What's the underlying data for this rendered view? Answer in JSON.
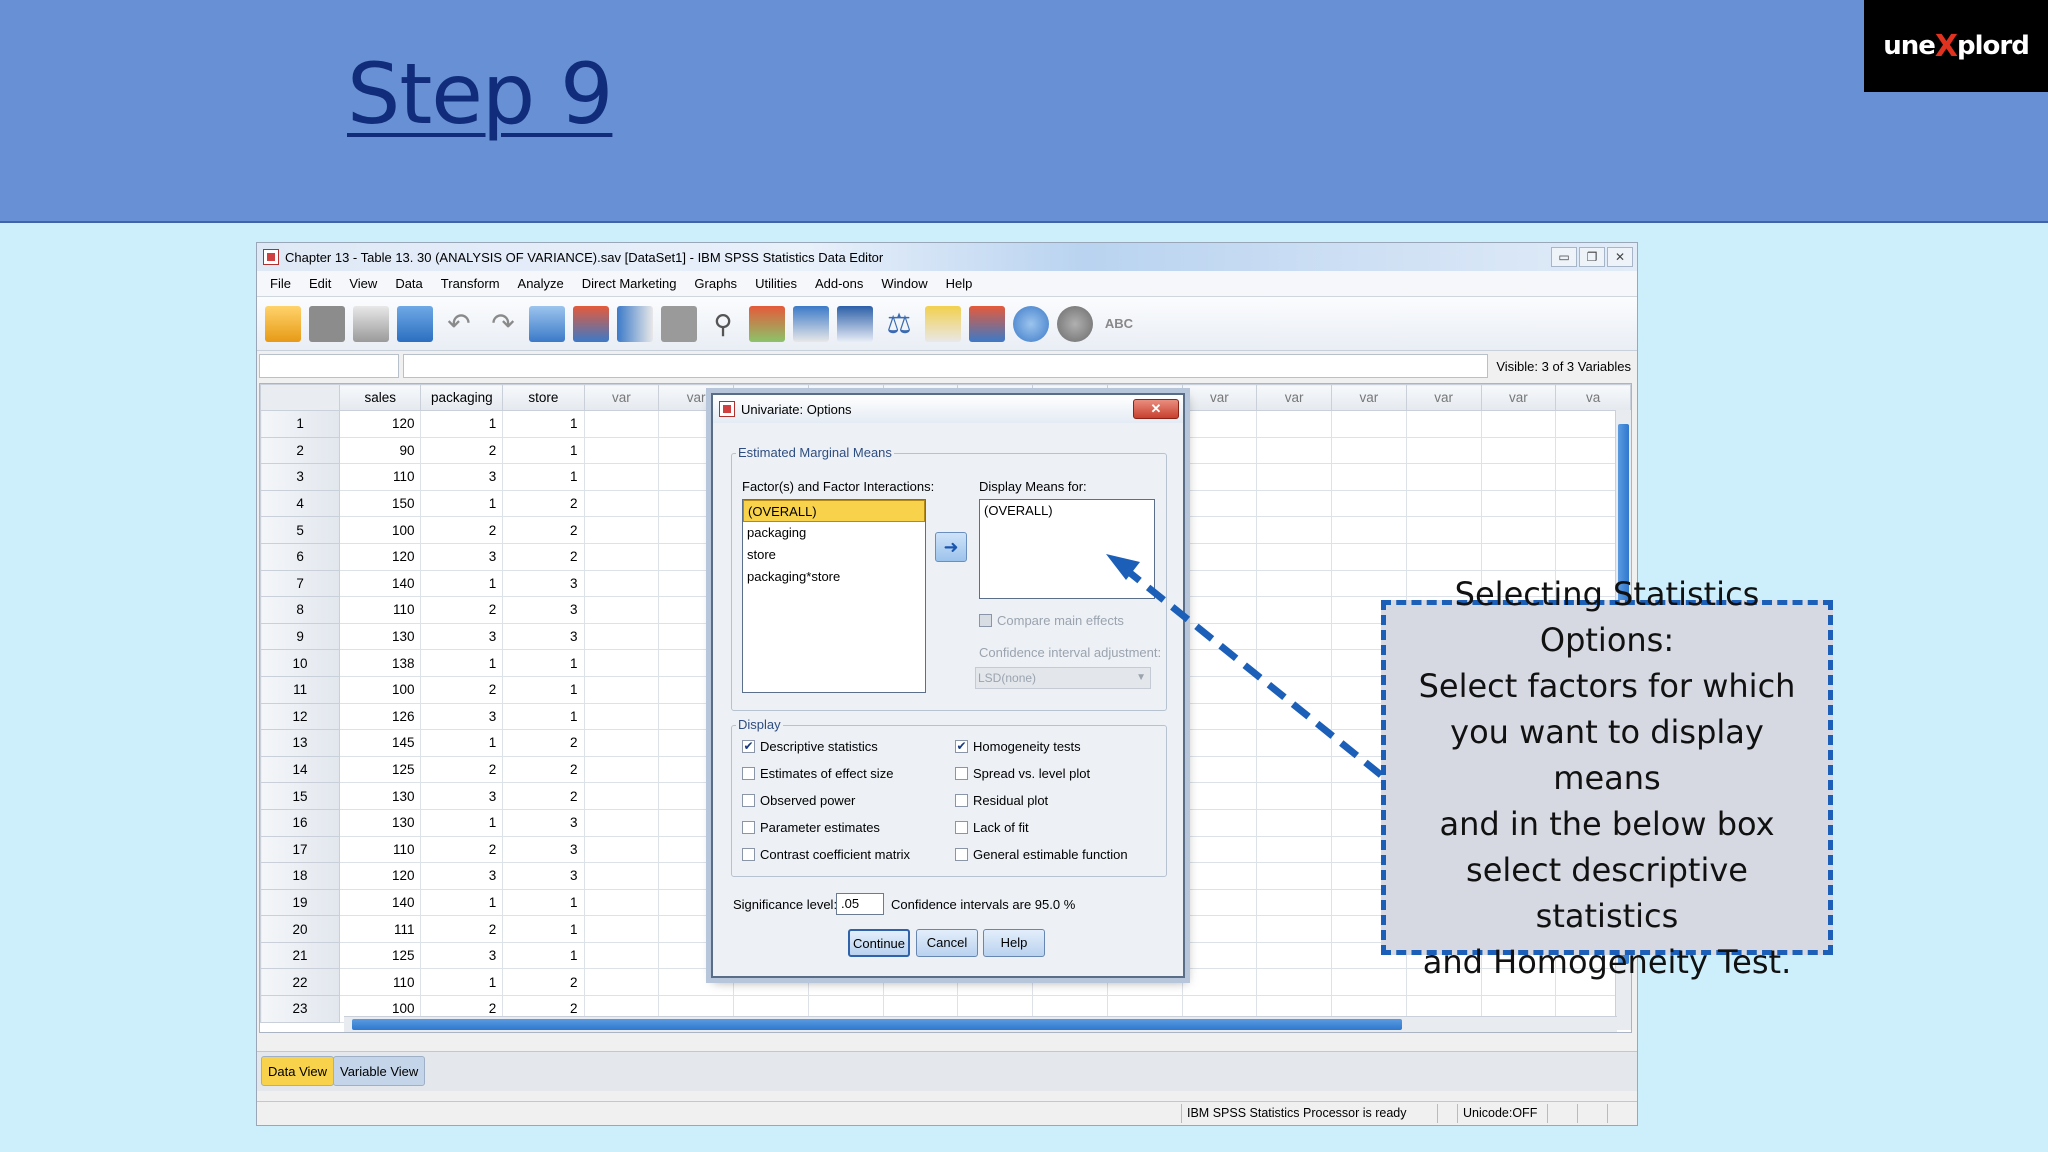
{
  "slide": {
    "title": "Step 9",
    "logo_prefix": "une",
    "logo_x": "X",
    "logo_suffix": "plord"
  },
  "window": {
    "title": "Chapter 13 - Table 13. 30 (ANALYSIS OF VARIANCE).sav [DataSet1] - IBM SPSS Statistics Data Editor",
    "menu": [
      "File",
      "Edit",
      "View",
      "Data",
      "Transform",
      "Analyze",
      "Direct Marketing",
      "Graphs",
      "Utilities",
      "Add-ons",
      "Window",
      "Help"
    ],
    "visible_info": "Visible: 3 of 3 Variables"
  },
  "grid": {
    "columns": [
      "sales",
      "packaging",
      "store",
      "var",
      "var",
      "var",
      "var",
      "var",
      "var",
      "var",
      "var",
      "var",
      "var",
      "var",
      "var",
      "var",
      "va"
    ],
    "rows": [
      [
        "1",
        "120",
        "1",
        "1"
      ],
      [
        "2",
        "90",
        "2",
        "1"
      ],
      [
        "3",
        "110",
        "3",
        "1"
      ],
      [
        "4",
        "150",
        "1",
        "2"
      ],
      [
        "5",
        "100",
        "2",
        "2"
      ],
      [
        "6",
        "120",
        "3",
        "2"
      ],
      [
        "7",
        "140",
        "1",
        "3"
      ],
      [
        "8",
        "110",
        "2",
        "3"
      ],
      [
        "9",
        "130",
        "3",
        "3"
      ],
      [
        "10",
        "138",
        "1",
        "1"
      ],
      [
        "11",
        "100",
        "2",
        "1"
      ],
      [
        "12",
        "126",
        "3",
        "1"
      ],
      [
        "13",
        "145",
        "1",
        "2"
      ],
      [
        "14",
        "125",
        "2",
        "2"
      ],
      [
        "15",
        "130",
        "3",
        "2"
      ],
      [
        "16",
        "130",
        "1",
        "3"
      ],
      [
        "17",
        "110",
        "2",
        "3"
      ],
      [
        "18",
        "120",
        "3",
        "3"
      ],
      [
        "19",
        "140",
        "1",
        "1"
      ],
      [
        "20",
        "111",
        "2",
        "1"
      ],
      [
        "21",
        "125",
        "3",
        "1"
      ],
      [
        "22",
        "110",
        "1",
        "2"
      ],
      [
        "23",
        "100",
        "2",
        "2"
      ]
    ]
  },
  "tabs": {
    "data_view": "Data View",
    "variable_view": "Variable View"
  },
  "status": {
    "ready": "IBM SPSS Statistics Processor is ready",
    "unicode": "Unicode:OFF"
  },
  "dialog": {
    "title": "Univariate: Options",
    "close": "✕",
    "emm_group": "Estimated Marginal Means",
    "factors_label": "Factor(s) and Factor Interactions:",
    "factors": [
      "(OVERALL)",
      "packaging",
      "store",
      "packaging*store"
    ],
    "display_means_label": "Display Means for:",
    "display_means": [
      "(OVERALL)"
    ],
    "compare_main_effects": "Compare main effects",
    "ci_adjustment_label": "Confidence interval adjustment:",
    "ci_adjustment_value": "LSD(none)",
    "display_group": "Display",
    "left_options": [
      {
        "label": "Descriptive statistics",
        "checked": true
      },
      {
        "label": "Estimates of effect size",
        "checked": false
      },
      {
        "label": "Observed power",
        "checked": false
      },
      {
        "label": "Parameter estimates",
        "checked": false
      },
      {
        "label": "Contrast coefficient matrix",
        "checked": false
      }
    ],
    "right_options": [
      {
        "label": "Homogeneity tests",
        "checked": true
      },
      {
        "label": "Spread vs. level plot",
        "checked": false
      },
      {
        "label": "Residual plot",
        "checked": false
      },
      {
        "label": "Lack of fit",
        "checked": false
      },
      {
        "label": "General estimable function",
        "checked": false
      }
    ],
    "significance_label": "Significance level:",
    "significance_value": ".05",
    "confidence_text": "Confidence intervals are 95.0 %",
    "buttons": {
      "continue": "Continue",
      "cancel": "Cancel",
      "help": "Help"
    }
  },
  "callout": {
    "lines": [
      "Selecting Statistics",
      "Options:",
      "Select factors for which",
      "you want to display means",
      "and in the below box",
      "select descriptive statistics",
      "and Homogeneity Test."
    ]
  },
  "colors": {
    "header": "#6890d4",
    "background": "#cdeffb",
    "callout_border": "#1b5fb8",
    "selection": "#f7d24a"
  }
}
